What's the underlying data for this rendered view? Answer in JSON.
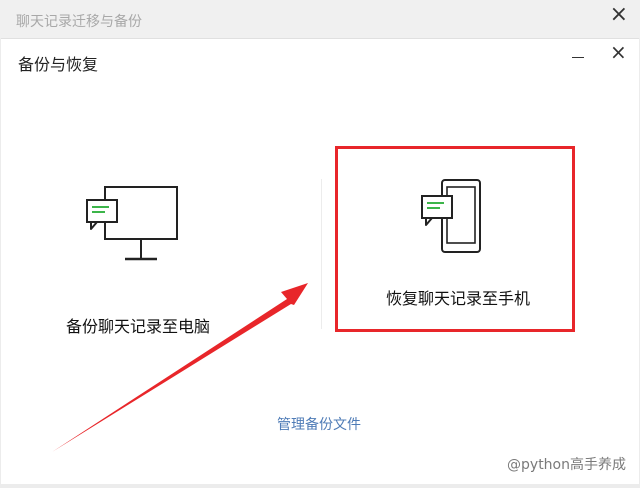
{
  "window": {
    "title": "聊天记录迁移与备份"
  },
  "dialog": {
    "title": "备份与恢复",
    "options": {
      "backup_to_pc": "备份聊天记录至电脑",
      "restore_to_phone": "恢复聊天记录至手机"
    },
    "manage_link": "管理备份文件"
  },
  "watermark": {
    "text": "@python高手养成"
  },
  "icons": {
    "outer_close": "close-icon",
    "minimize": "minimize-icon",
    "dialog_close": "close-icon",
    "pc": "monitor-chat-icon",
    "phone": "phone-chat-icon"
  },
  "colors": {
    "highlight_border": "#e8262a",
    "chat_bubble_green": "#3cb54a",
    "link_blue": "#4e7bb6",
    "arrow_red": "#e8262a"
  }
}
